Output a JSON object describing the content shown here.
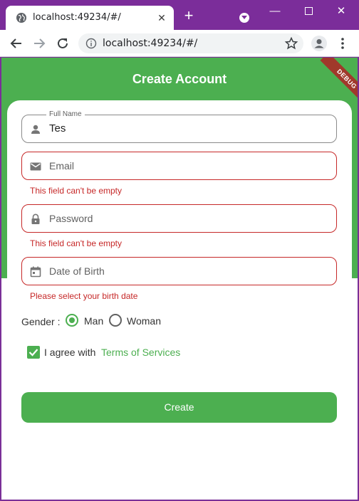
{
  "browser": {
    "tab_title": "localhost:49234/#/",
    "url": "localhost:49234/#/",
    "icons": {
      "favicon": "globe-icon",
      "close_tab": "close-icon",
      "new_tab": "plus-icon",
      "tab_search": "chevron-down-icon",
      "minimize": "minimize-icon",
      "maximize": "maximize-icon",
      "close_window": "close-icon",
      "back": "back-arrow-icon",
      "forward": "forward-arrow-icon",
      "reload": "reload-icon",
      "site_info": "info-icon",
      "bookmark": "star-icon",
      "profile": "person-icon",
      "menu": "more-vert-icon"
    }
  },
  "app": {
    "title": "Create Account",
    "debug_banner": "DEBUG",
    "colors": {
      "primary": "#4caf50",
      "error": "#c62828",
      "titlebar": "#7b2d9a"
    },
    "fields": {
      "full_name": {
        "label": "Full Name",
        "value": "Tes",
        "icon": "person-icon"
      },
      "email": {
        "placeholder": "Email",
        "error": "This field can't be empty",
        "icon": "mail-icon"
      },
      "password": {
        "placeholder": "Password",
        "error": "This field can't be empty",
        "icon": "lock-icon"
      },
      "dob": {
        "placeholder": "Date of Birth",
        "error": "Please select your birth date",
        "icon": "calendar-icon"
      }
    },
    "gender": {
      "label": "Gender :",
      "options": [
        {
          "label": "Man",
          "selected": true
        },
        {
          "label": "Woman",
          "selected": false
        }
      ]
    },
    "agree": {
      "text": "I agree with",
      "link": "Terms of Services",
      "checked": true
    },
    "create_button": "Create"
  }
}
